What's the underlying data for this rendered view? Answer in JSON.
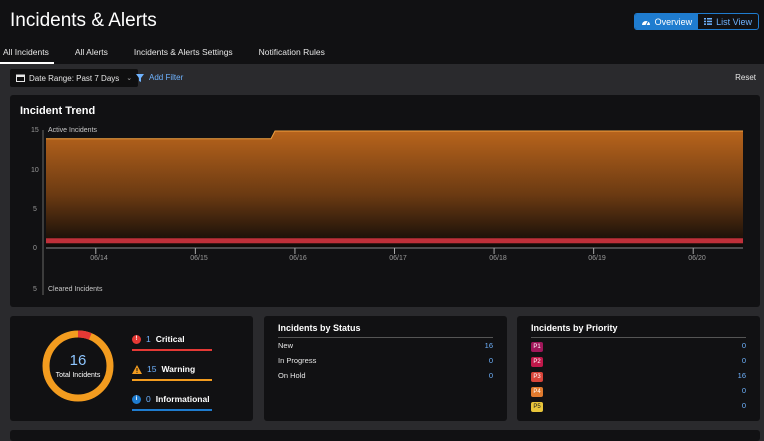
{
  "header": {
    "title": "Incidents & Alerts",
    "views": [
      "Overview",
      "List View"
    ],
    "active_view": "Overview"
  },
  "tabs": [
    "All Incidents",
    "All Alerts",
    "Incidents & Alerts Settings",
    "Notification Rules"
  ],
  "filters": {
    "date_range": "Date Range: Past 7 Days",
    "add_filter": "Add Filter",
    "reset": "Reset"
  },
  "trend": {
    "title": "Incident Trend",
    "active_label": "Active Incidents",
    "cleared_label": "Cleared Incidents",
    "y_ticks": [
      "15",
      "10",
      "5",
      "0"
    ],
    "cleared_tick": "5",
    "x_ticks": [
      "06/14",
      "06/15",
      "06/16",
      "06/17",
      "06/18",
      "06/19",
      "06/20"
    ]
  },
  "chart_data": {
    "type": "area",
    "title": "Incident Trend",
    "x": [
      "06/14",
      "06/15",
      "06/16",
      "06/17",
      "06/18",
      "06/19",
      "06/20"
    ],
    "series": [
      {
        "name": "Active Incidents",
        "values": [
          14,
          14,
          15,
          15,
          15,
          15,
          15
        ]
      },
      {
        "name": "Cleared Incidents",
        "values": [
          1,
          1,
          1,
          1,
          1,
          1,
          1
        ]
      }
    ],
    "ylim": [
      0,
      15
    ]
  },
  "summary": {
    "total": "16",
    "total_label": "Total Incidents",
    "severities": [
      {
        "count": "1",
        "label": "Critical",
        "color": "#e53935",
        "icon": "!",
        "icon_name": "critical-icon"
      },
      {
        "count": "15",
        "label": "Warning",
        "color": "#f39c1f",
        "icon": "!",
        "icon_name": "warning-icon"
      },
      {
        "count": "0",
        "label": "Informational",
        "color": "#1f7ccf",
        "icon": "i",
        "icon_name": "info-icon"
      }
    ]
  },
  "status": {
    "title": "Incidents by Status",
    "rows": [
      {
        "label": "New",
        "value": "16"
      },
      {
        "label": "In Progress",
        "value": "0"
      },
      {
        "label": "On Hold",
        "value": "0"
      }
    ]
  },
  "priority": {
    "title": "Incidents by Priority",
    "rows": [
      {
        "label": "P1",
        "value": "0",
        "color": "#a0175a"
      },
      {
        "label": "P2",
        "value": "0",
        "color": "#c0184a"
      },
      {
        "label": "P3",
        "value": "16",
        "color": "#d9453a"
      },
      {
        "label": "P4",
        "value": "0",
        "color": "#e07a2e"
      },
      {
        "label": "P5",
        "value": "0",
        "color": "#e8c53a"
      }
    ]
  }
}
